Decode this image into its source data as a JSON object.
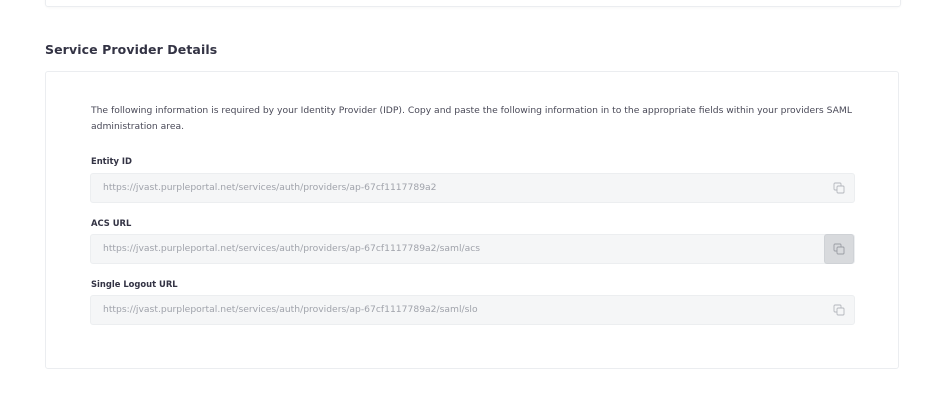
{
  "section": {
    "title": "Service Provider Details"
  },
  "card": {
    "description": "The following information is required by your Identity Provider (IDP). Copy and paste the following information in to the appropriate fields within your providers SAML administration area.",
    "fields": [
      {
        "label": "Entity ID",
        "value": "https://jvast.purpleportal.net/services/auth/providers/ap-67cf1117789a2",
        "copy_icon": "copy-icon"
      },
      {
        "label": "ACS URL",
        "value": "https://jvast.purpleportal.net/services/auth/providers/ap-67cf1117789a2/saml/acs",
        "copy_icon": "copy-icon"
      },
      {
        "label": "Single Logout URL",
        "value": "https://jvast.purpleportal.net/services/auth/providers/ap-67cf1117789a2/saml/slo",
        "copy_icon": "copy-icon"
      }
    ]
  },
  "colors": {
    "field_background": "#f5f6f7",
    "value_text": "#a0a3ab",
    "copy_hover_background": "#d8dadd"
  }
}
